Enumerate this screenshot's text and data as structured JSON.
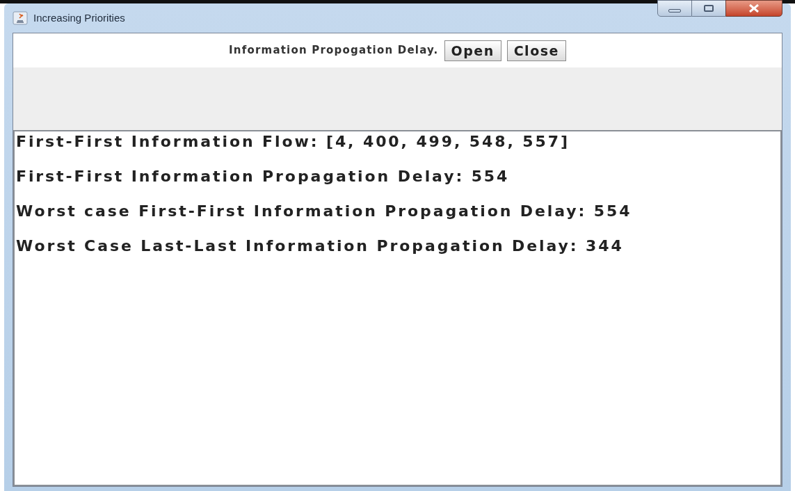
{
  "window": {
    "title": "Increasing Priorities"
  },
  "toolbar": {
    "label": "Information Propogation Delay.",
    "buttons": [
      "Open",
      "Close"
    ]
  },
  "output_lines": [
    "First-First Information Flow: [4, 400, 499, 548, 557]",
    "First-First Information Propagation Delay: 554",
    "Worst case First-First Information Propagation Delay: 554",
    "Worst Case Last-Last Information Propagation Delay: 344"
  ]
}
